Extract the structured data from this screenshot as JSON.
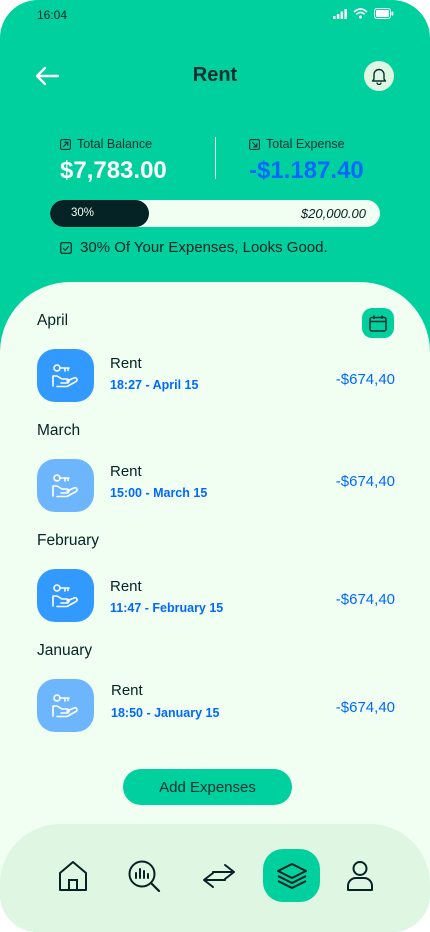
{
  "status_bar": {
    "time": "16:04"
  },
  "header": {
    "title": "Rent"
  },
  "balances": {
    "total_balance_label": "Total Balance",
    "total_balance_value": "$7,783.00",
    "total_expense_label": "Total Expense",
    "total_expense_value": "-$1.187.40"
  },
  "progress": {
    "percent_label": "30%",
    "percent": 30,
    "goal": "$20,000.00"
  },
  "note": "30% Of Your Expenses, Looks Good.",
  "months": [
    {
      "label": "April",
      "tx": {
        "title": "Rent",
        "time": "18:27 - April 15",
        "amount": "-$674,40"
      }
    },
    {
      "label": "March",
      "tx": {
        "title": "Rent",
        "time": "15:00 - March 15",
        "amount": "-$674,40"
      }
    },
    {
      "label": "February",
      "tx": {
        "title": "Rent",
        "time": "11:47 - February 15",
        "amount": "-$674,40"
      }
    },
    {
      "label": "January",
      "tx": {
        "title": "Rent",
        "time": "18:50 - January 15",
        "amount": "-$674,40"
      }
    }
  ],
  "add_button": "Add Expenses",
  "nav": {
    "items": [
      "home-icon",
      "analysis-icon",
      "transactions-icon",
      "categories-icon",
      "profile-icon"
    ],
    "active": "categories-icon"
  },
  "colors": {
    "primary": "#00d09e",
    "background": "#f1fff3",
    "nav_background": "#dff7e2",
    "accent_blue": "#0068ff",
    "dark": "#052224"
  }
}
